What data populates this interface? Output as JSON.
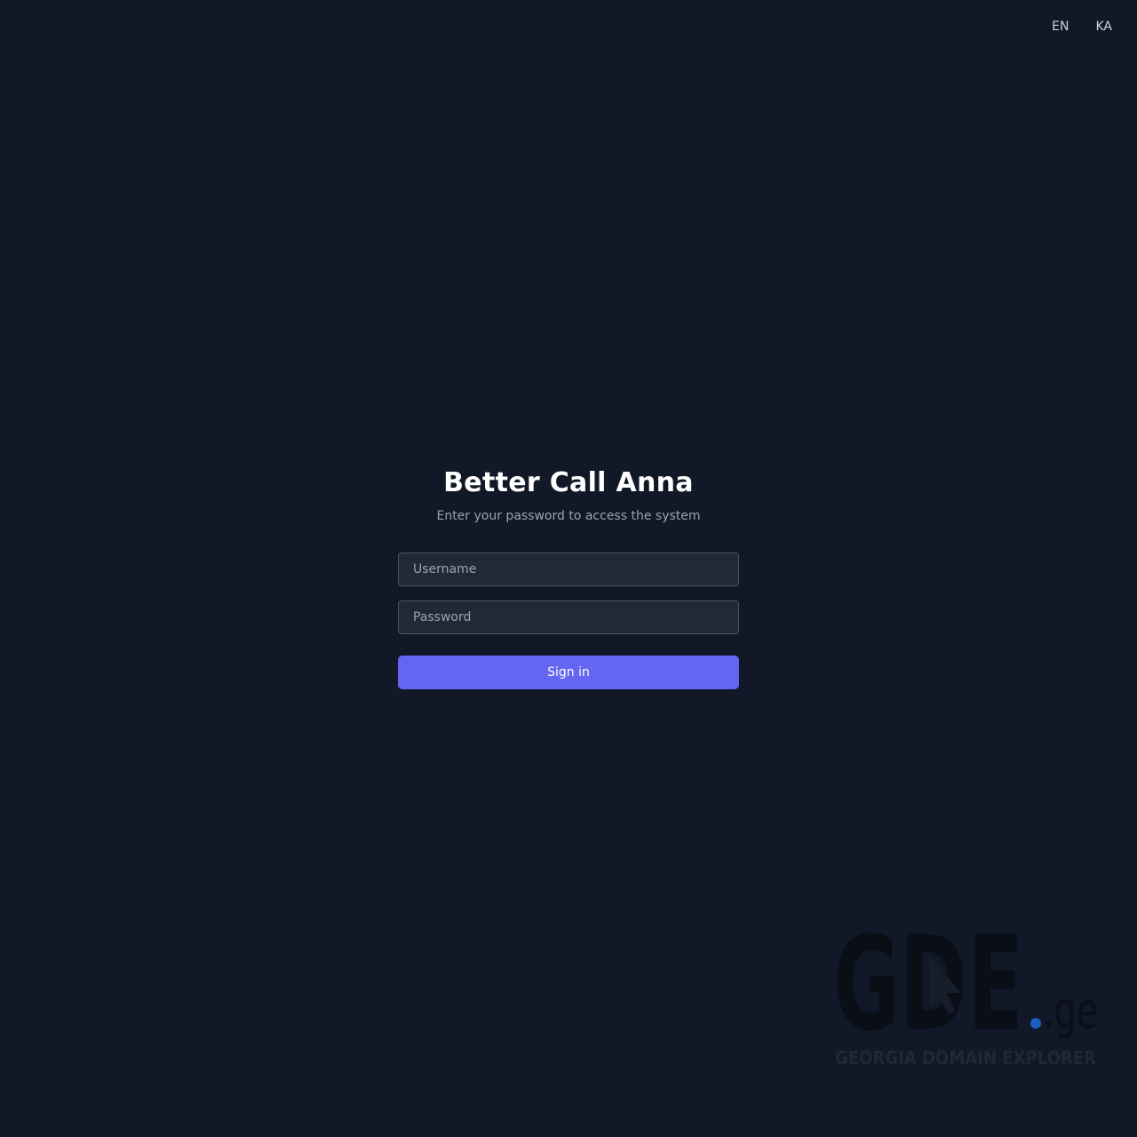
{
  "lang_switch": {
    "en_label": "EN",
    "ka_label": "KA"
  },
  "login": {
    "title": "Better Call Anna",
    "subtitle": "Enter your password to access the system",
    "username_placeholder": "Username",
    "password_placeholder": "Password",
    "submit_label": "Sign in"
  },
  "watermark": {
    "logo_text": "GDE",
    "logo_suffix": ".ge",
    "tagline": "GEORGIA DOMAIN EXPLORER",
    "dot_color": "#1d5fbf"
  },
  "colors": {
    "background": "#111827",
    "accent": "#6366f1",
    "input_background": "#1f2937"
  }
}
